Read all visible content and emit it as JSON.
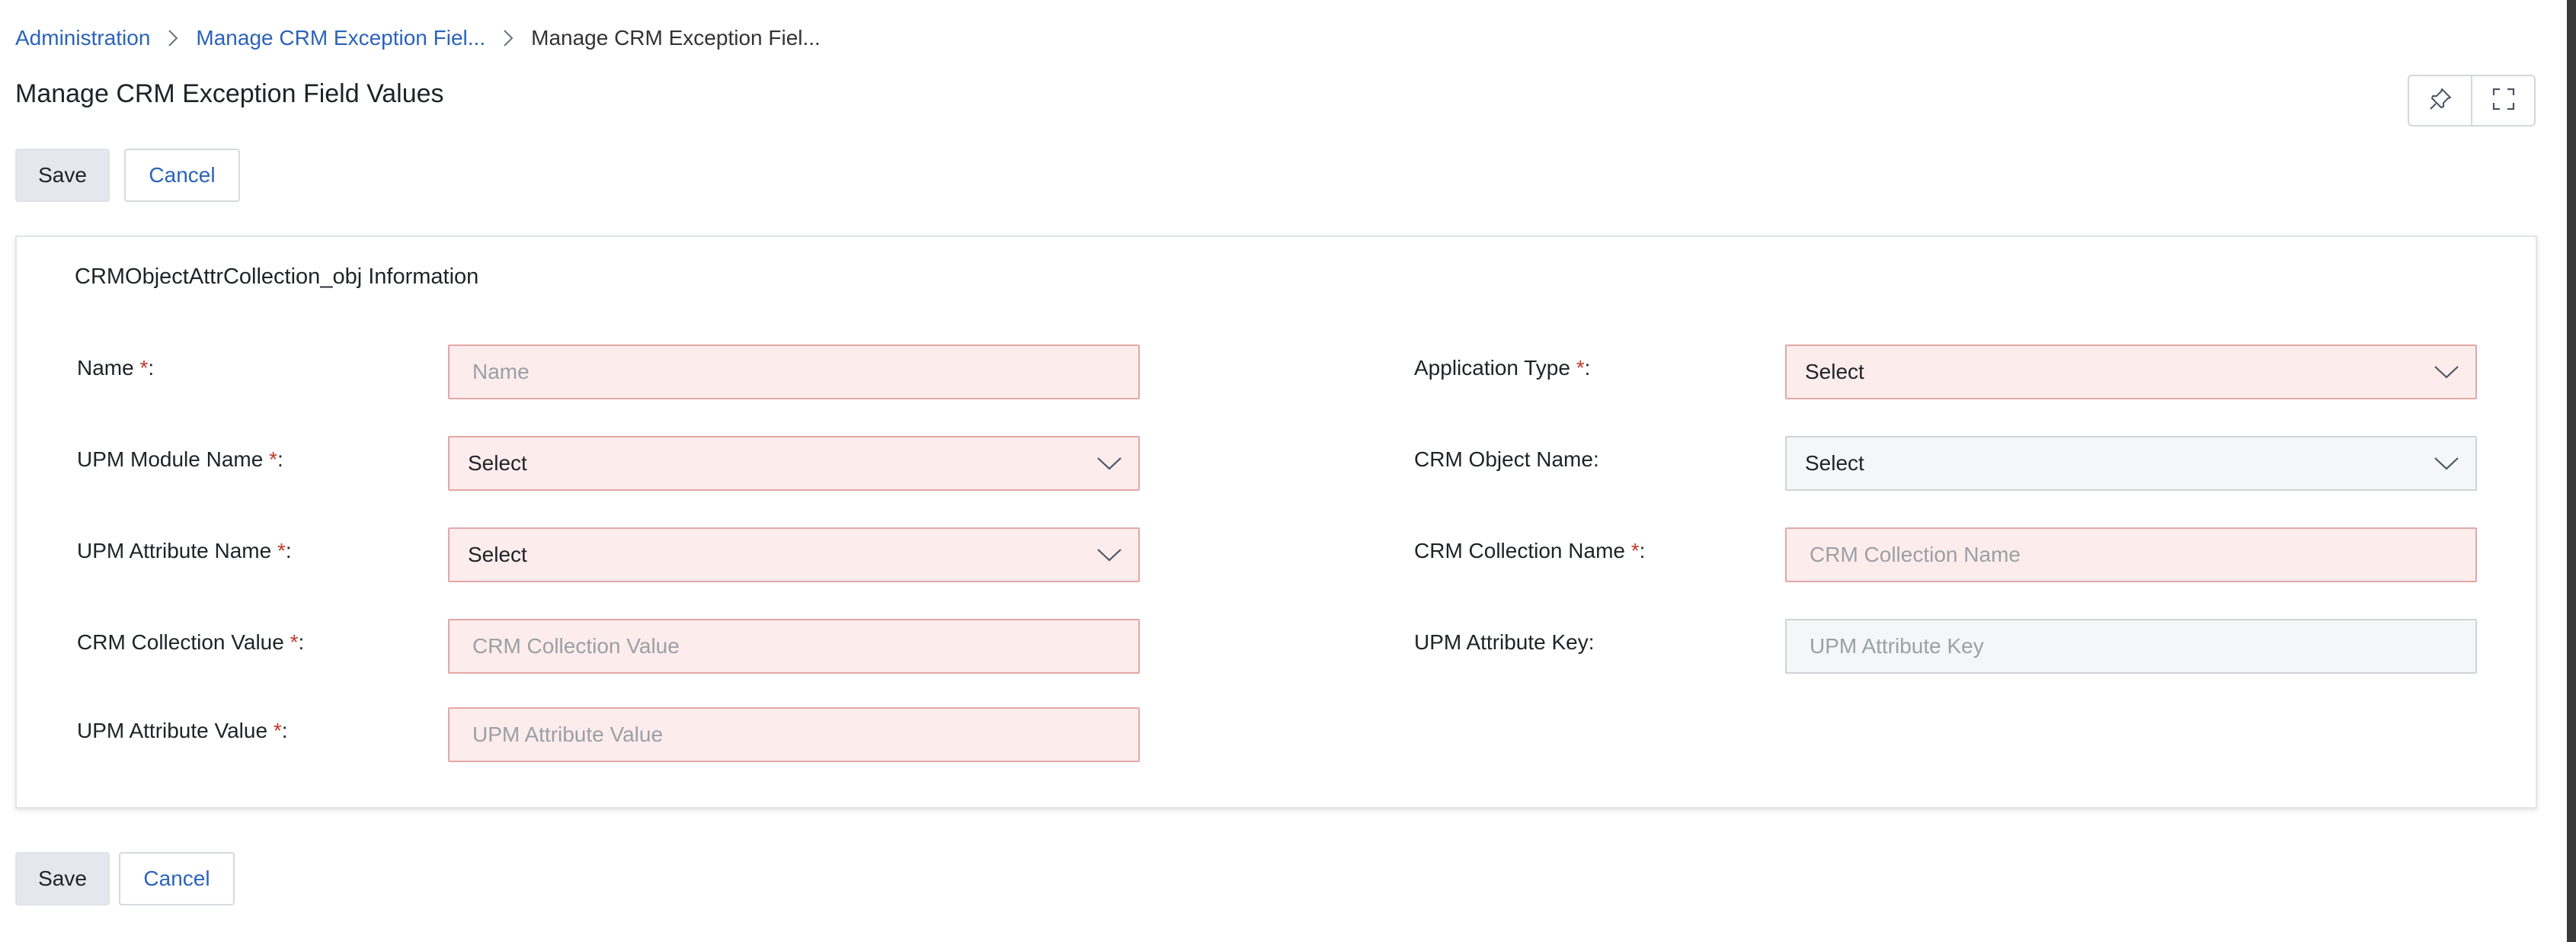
{
  "breadcrumb": {
    "items": [
      "Administration",
      "Manage CRM Exception Fiel...",
      "Manage CRM Exception Fiel..."
    ]
  },
  "page": {
    "title": "Manage CRM Exception Field Values"
  },
  "actions": {
    "save_label": "Save",
    "cancel_label": "Cancel"
  },
  "toolbar_icons": [
    "pin-icon",
    "expand-icon"
  ],
  "panel": {
    "title": "CRMObjectAttrCollection_obj Information"
  },
  "required_mark": "*",
  "form": {
    "name": {
      "label": "Name",
      "placeholder": "Name"
    },
    "application_type": {
      "label": "Application Type",
      "value": "Select"
    },
    "upm_module_name": {
      "label": "UPM Module Name",
      "value": "Select"
    },
    "crm_object_name": {
      "label": "CRM Object Name:",
      "value": "Select"
    },
    "upm_attribute_name": {
      "label": "UPM Attribute Name",
      "value": "Select"
    },
    "crm_collection_name": {
      "label": "CRM Collection Name",
      "placeholder": "CRM Collection Name"
    },
    "crm_collection_value": {
      "label": "CRM Collection Value",
      "placeholder": "CRM Collection Value"
    },
    "upm_attribute_key": {
      "label": "UPM Attribute Key:",
      "placeholder": "UPM Attribute Key"
    },
    "upm_attribute_value": {
      "label": "UPM Attribute Value",
      "placeholder": "UPM Attribute Value"
    }
  },
  "colors": {
    "link": "#2b63b8",
    "required": "#c0392b",
    "invalid_bg": "#fdecec",
    "invalid_border": "#e3a7a7"
  }
}
